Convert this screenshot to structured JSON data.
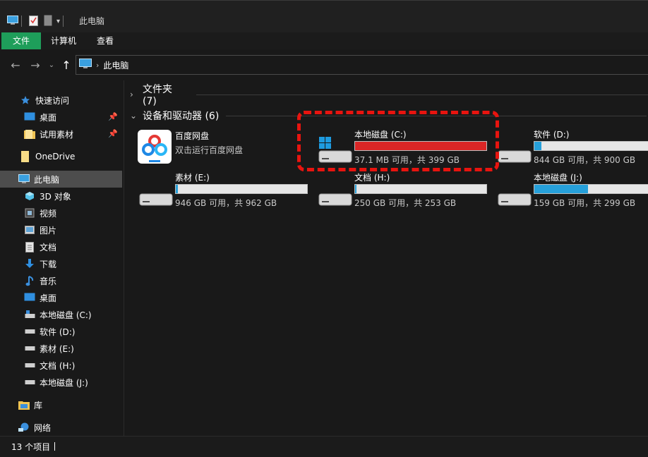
{
  "window": {
    "title": "此电脑"
  },
  "ribbon": {
    "tabs": [
      {
        "label": "文件"
      },
      {
        "label": "计算机"
      },
      {
        "label": "查看"
      }
    ]
  },
  "address": {
    "crumbs": [
      {
        "label": "此电脑"
      }
    ]
  },
  "sidebar": {
    "items": [
      {
        "label": "快速访问",
        "icon": "star-icon",
        "pinned": false,
        "active": false
      },
      {
        "label": "桌面",
        "icon": "desktop-icon",
        "pinned": true,
        "active": false
      },
      {
        "label": "试用素材",
        "icon": "folder-icon",
        "pinned": true,
        "active": false
      },
      {
        "label": "OneDrive",
        "icon": "folder-icon",
        "pinned": false,
        "active": false
      },
      {
        "label": "此电脑",
        "icon": "computer-icon",
        "pinned": false,
        "active": true
      },
      {
        "label": "3D 对象",
        "icon": "cube-icon",
        "pinned": false,
        "active": false
      },
      {
        "label": "视频",
        "icon": "video-icon",
        "pinned": false,
        "active": false
      },
      {
        "label": "图片",
        "icon": "picture-icon",
        "pinned": false,
        "active": false
      },
      {
        "label": "文档",
        "icon": "document-icon",
        "pinned": false,
        "active": false
      },
      {
        "label": "下载",
        "icon": "download-icon",
        "pinned": false,
        "active": false
      },
      {
        "label": "音乐",
        "icon": "music-icon",
        "pinned": false,
        "active": false
      },
      {
        "label": "桌面",
        "icon": "desktop-icon",
        "pinned": false,
        "active": false
      },
      {
        "label": "本地磁盘 (C:)",
        "icon": "drive-icon",
        "pinned": false,
        "active": false
      },
      {
        "label": "软件 (D:)",
        "icon": "drive-icon",
        "pinned": false,
        "active": false
      },
      {
        "label": "素材 (E:)",
        "icon": "drive-icon",
        "pinned": false,
        "active": false
      },
      {
        "label": "文档 (H:)",
        "icon": "drive-icon",
        "pinned": false,
        "active": false
      },
      {
        "label": "本地磁盘 (J:)",
        "icon": "drive-icon",
        "pinned": false,
        "active": false
      },
      {
        "label": "库",
        "icon": "library-icon",
        "pinned": false,
        "active": false
      },
      {
        "label": "网络",
        "icon": "network-icon",
        "pinned": false,
        "active": false
      }
    ]
  },
  "main": {
    "groups": [
      {
        "label": "文件夹 (7)",
        "expanded": false
      },
      {
        "label": "设备和驱动器 (6)",
        "expanded": true
      }
    ],
    "devices": [
      {
        "name": "百度网盘",
        "info": "双击运行百度网盘",
        "type": "app"
      },
      {
        "name": "本地磁盘 (C:)",
        "info": "37.1 MB 可用，共 399 GB",
        "type": "drive",
        "used_fraction": 1.0,
        "warning": true,
        "system": true
      },
      {
        "name": "软件 (D:)",
        "info": "844 GB 可用，共 900 GB",
        "type": "drive",
        "used_fraction": 0.06,
        "warning": false
      },
      {
        "name": "素材 (E:)",
        "info": "946 GB 可用，共 962 GB",
        "type": "drive",
        "used_fraction": 0.017,
        "warning": false
      },
      {
        "name": "文档 (H:)",
        "info": "250 GB 可用，共 253 GB",
        "type": "drive",
        "used_fraction": 0.012,
        "warning": false
      },
      {
        "name": "本地磁盘 (J:)",
        "info": "159 GB 可用，共 299 GB",
        "type": "drive",
        "used_fraction": 0.47,
        "warning": false
      }
    ]
  },
  "statusbar": {
    "item_count": "13 个项目"
  },
  "colors": {
    "accent": "#1e9e5a",
    "bar_normal": "#26a0da",
    "bar_warning": "#da2626",
    "highlight": "#e8140f"
  }
}
